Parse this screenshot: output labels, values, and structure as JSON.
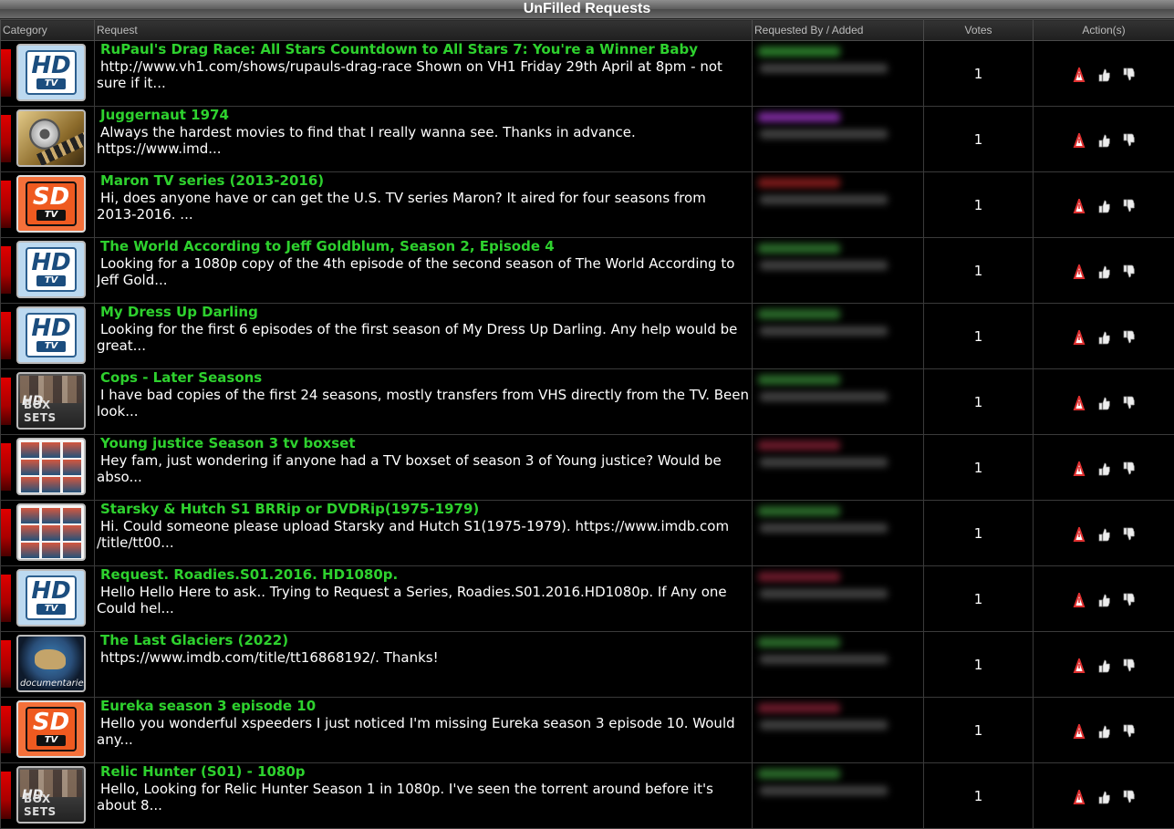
{
  "page_title": "UnFilled Requests",
  "columns": {
    "category": "Category",
    "request": "Request",
    "requested_by": "Requested By / Added",
    "votes": "Votes",
    "actions": "Action(s)"
  },
  "colors": {
    "title_green": "#2ed12e",
    "category_bar_red": "#e00000",
    "report_red": "#e03030"
  },
  "rows": [
    {
      "category_icon": "hd-tv-icon",
      "category_text": [
        "HD",
        "TV"
      ],
      "title": "RuPaul's Drag Race: All Stars Countdown to All Stars 7: You're a Winner Baby",
      "desc1": "http://www.vh1.com/shows/rupauls-drag-race Shown on VH1 Friday 29th April at 8pm - not",
      "desc2": "sure if it...",
      "user_color": "#2a7a2a",
      "votes": "1"
    },
    {
      "category_icon": "movie-film-icon",
      "category_text": [],
      "title": "Juggernaut 1974",
      "desc1": "Always the hardest movies to find that I really wanna see. Thanks in advance.",
      "desc2": "https://www.imd...",
      "user_color": "#7a2a9a",
      "votes": "1"
    },
    {
      "category_icon": "sd-tv-icon",
      "category_text": [
        "SD",
        "TV"
      ],
      "title": "Maron TV series (2013-2016)",
      "desc1": "Hi, does anyone have or can get the U.S. TV series Maron? It aired for four seasons from",
      "desc2": "2013-2016. ...",
      "user_color": "#7a1a1a",
      "votes": "1"
    },
    {
      "category_icon": "hd-tv-icon",
      "category_text": [
        "HD",
        "TV"
      ],
      "title": "The World According to Jeff Goldblum, Season 2, Episode 4",
      "desc1": "Looking for a 1080p copy of the 4th episode of the second season of The World According to",
      "desc2": "Jeff Gold...",
      "user_color": "#2a6a2a",
      "votes": "1"
    },
    {
      "category_icon": "hd-tv-icon",
      "category_text": [
        "HD",
        "TV"
      ],
      "title": "My Dress Up Darling",
      "desc1": "Looking for the first 6 episodes of the first season of My Dress Up Darling. Any help would be",
      "desc2": "great...",
      "user_color": "#2a6a2a",
      "votes": "1"
    },
    {
      "category_icon": "hd-box-sets-icon",
      "category_text": [
        "HD",
        "BOX SETS"
      ],
      "title": "Cops - Later Seasons",
      "desc1": "I have bad copies of the first 24 seasons, mostly transfers from VHS directly from the TV. Been",
      "desc2": "look...",
      "user_color": "#2a6a2a",
      "votes": "1"
    },
    {
      "category_icon": "tv-boxset-icon",
      "category_text": [],
      "title": "Young justice Season 3 tv boxset",
      "desc1": "Hey fam, just wondering if anyone had a TV boxset of season 3 of Young justice? Would be",
      "desc2": "abso...",
      "user_color": "#6a1a2a",
      "votes": "1"
    },
    {
      "category_icon": "tv-boxset-icon",
      "category_text": [],
      "title": "Starsky & Hutch S1 BRRip or DVDRip(1975-1979)",
      "desc1": "Hi. Could someone please upload Starsky and Hutch S1(1975-1979). https://www.imdb.com",
      "desc2": "/title/tt00...",
      "user_color": "#2a6a2a",
      "votes": "1"
    },
    {
      "category_icon": "hd-tv-icon",
      "category_text": [
        "HD",
        "TV"
      ],
      "title": "Request. Roadies.S01.2016. HD1080p.",
      "desc1": "Hello Hello Here to ask.. Trying to Request a Series, Roadies.S01.2016.HD1080p. If Any one",
      "desc2": "Could hel...",
      "user_color": "#6a1a2a",
      "votes": "1"
    },
    {
      "category_icon": "documentaries-icon",
      "category_text": [
        "documentaries"
      ],
      "title": "The Last Glaciers (2022)",
      "desc1": "https://www.imdb.com/title/tt16868192/. Thanks!",
      "desc2": "",
      "user_color": "#2a6a2a",
      "votes": "1"
    },
    {
      "category_icon": "sd-tv-icon",
      "category_text": [
        "SD",
        "TV"
      ],
      "title": "Eureka season 3 episode 10",
      "desc1": "Hello you wonderful xspeeders I just noticed I'm missing Eureka season 3 episode 10. Would",
      "desc2": "any...",
      "user_color": "#6a1a2a",
      "votes": "1"
    },
    {
      "category_icon": "hd-box-sets-icon",
      "category_text": [
        "HD",
        "BOX SETS"
      ],
      "title": "Relic Hunter (S01) - 1080p",
      "desc1": "Hello, Looking for Relic Hunter Season 1 in 1080p. I've seen the torrent around before it's",
      "desc2": "about 8...",
      "user_color": "#2a6a2a",
      "votes": "1"
    }
  ]
}
